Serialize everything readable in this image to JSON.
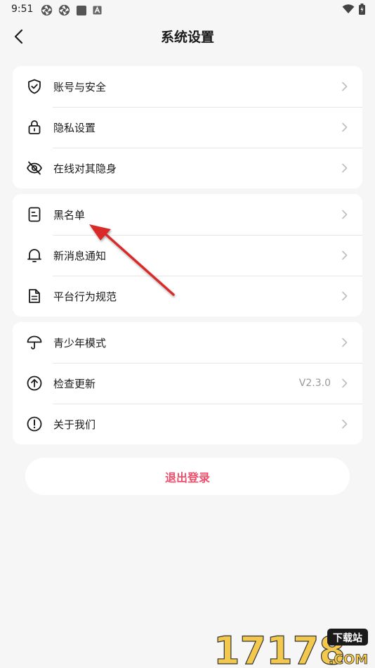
{
  "status_bar": {
    "time": "9:51",
    "left_icons": [
      "aperture-icon",
      "aperture-icon",
      "square-icon",
      "a-box-icon"
    ],
    "right_icons": [
      "wifi-icon",
      "battery-icon"
    ]
  },
  "header": {
    "title": "系统设置",
    "back_icon": "chevron-left-icon"
  },
  "groups": [
    {
      "items": [
        {
          "label": "账号与安全",
          "icon": "shield-check-icon"
        },
        {
          "label": "隐私设置",
          "icon": "lock-icon"
        },
        {
          "label": "在线对其隐身",
          "icon": "eye-off-icon"
        }
      ]
    },
    {
      "items": [
        {
          "label": "黑名单",
          "icon": "blacklist-doc-icon"
        },
        {
          "label": "新消息通知",
          "icon": "bell-icon"
        },
        {
          "label": "平台行为规范",
          "icon": "document-icon"
        }
      ]
    },
    {
      "items": [
        {
          "label": "青少年模式",
          "icon": "umbrella-icon"
        },
        {
          "label": "检查更新",
          "icon": "arrow-up-circle-icon",
          "value": "V2.3.0"
        },
        {
          "label": "关于我们",
          "icon": "info-circle-icon"
        }
      ]
    }
  ],
  "logout_label": "退出登录",
  "colors": {
    "accent": "#ef4f6c",
    "arrow": "#d92b2b",
    "background": "#f6f6f6"
  },
  "watermark": {
    "number": "17178",
    "badge": "下载站",
    "domain": ".COM"
  }
}
